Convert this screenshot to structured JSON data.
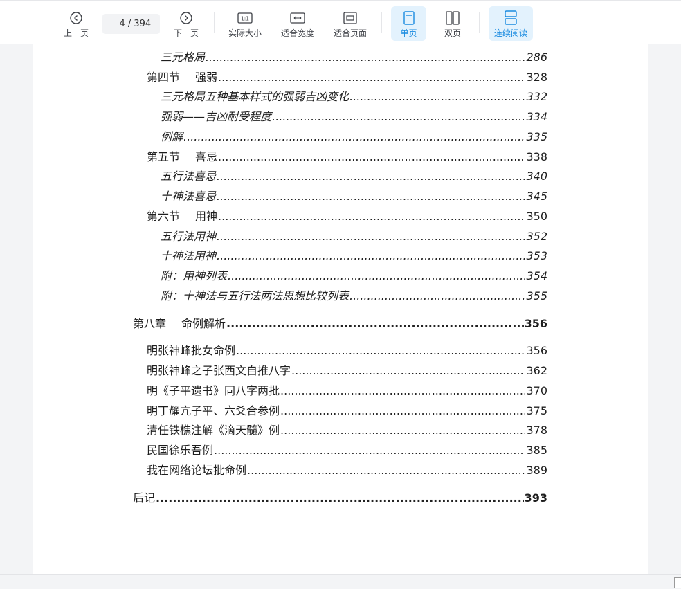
{
  "toolbar": {
    "prev_label": "上一页",
    "next_label": "下一页",
    "current_page": "4",
    "total_pages": "/ 394",
    "actual_size_label": "实际大小",
    "actual_size_icon_text": "1:1",
    "fit_width_label": "适合宽度",
    "fit_page_label": "适合页面",
    "single_page_label": "单页",
    "double_page_label": "双页",
    "continuous_label": "连续阅读",
    "accent": "#1a8be0"
  },
  "toc": {
    "r1": {
      "title": "三元格局",
      "page": "286"
    },
    "r2": {
      "title": "第四节",
      "title2": "强弱",
      "page": "328"
    },
    "r3": {
      "title": "三元格局五种基本样式的强弱吉凶变化",
      "page": "332"
    },
    "r4": {
      "title": "强弱——吉凶耐受程度",
      "page": "334"
    },
    "r5": {
      "title": "例解",
      "page": "335"
    },
    "r6": {
      "title": "第五节",
      "title2": "喜忌",
      "page": "338"
    },
    "r7": {
      "title": "五行法喜忌",
      "page": "340"
    },
    "r8": {
      "title": "十神法喜忌",
      "page": "345"
    },
    "r9": {
      "title": "第六节",
      "title2": "用神",
      "page": "350"
    },
    "r10": {
      "title": "五行法用神",
      "page": "352"
    },
    "r11": {
      "title": "十神法用神",
      "page": "353"
    },
    "r12": {
      "title": "附：用神列表",
      "page": "354"
    },
    "r13": {
      "title": "附：十神法与五行法两法思想比较列表",
      "page": "355"
    },
    "r14": {
      "title": "第八章",
      "title2": "命例解析",
      "page": "356"
    },
    "r15": {
      "title": "明张神峰批女命例",
      "page": "356"
    },
    "r16": {
      "title": "明张神峰之子张西文自推八字",
      "page": "362"
    },
    "r17": {
      "title": "明《子平遗书》同八字两批",
      "page": "370"
    },
    "r18": {
      "title": "明丁耀亢子平、六爻合参例",
      "page": "375"
    },
    "r19": {
      "title": "清任铁樵注解《滴天髓》例",
      "page": "378"
    },
    "r20": {
      "title": "民国徐乐吾例",
      "page": "385"
    },
    "r21": {
      "title": "我在网络论坛批命例",
      "page": "389"
    },
    "r22": {
      "title": "后记",
      "page": "393"
    }
  }
}
